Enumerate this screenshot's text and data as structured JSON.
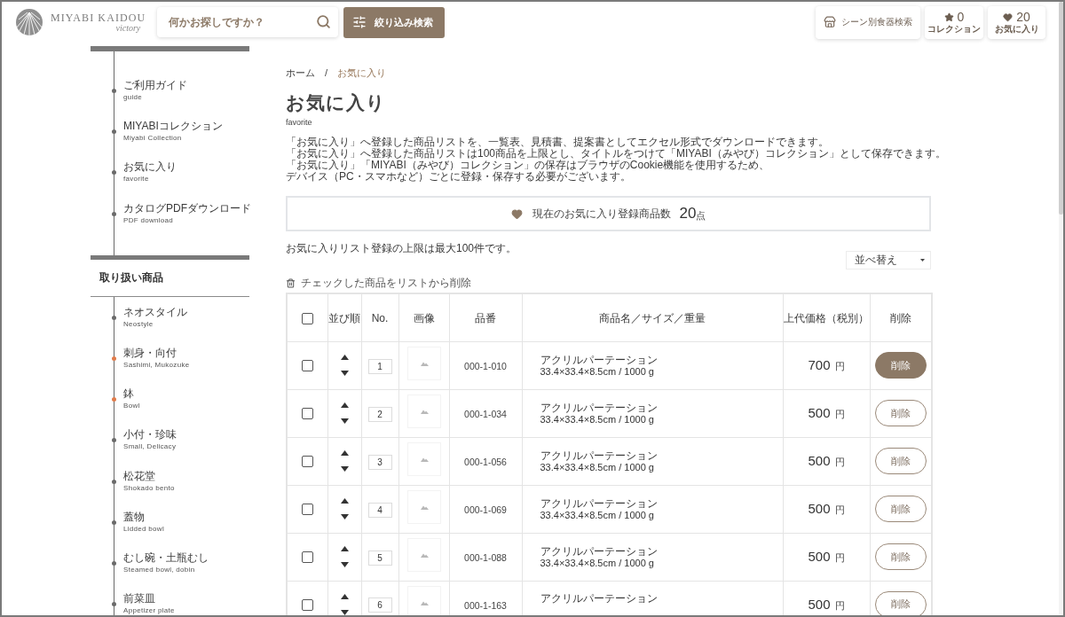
{
  "header": {
    "logo": {
      "name": "MIYABI KAIDOU",
      "tagline": "victory"
    },
    "search": {
      "placeholder": "何かお探しですか？"
    },
    "filter_button": "絞り込み検索",
    "scene_button": "シーン別食器検索",
    "collection_button": {
      "count": "0",
      "label": "コレクション"
    },
    "favorites_button": {
      "count": "20",
      "label": "お気に入り"
    }
  },
  "sidebar": {
    "guide_items": [
      {
        "label": "ご利用ガイド",
        "sublabel": "guide"
      },
      {
        "label": "MIYABIコレクション",
        "sublabel": "Miyabi Collection"
      },
      {
        "label": "お気に入り",
        "sublabel": "favorite"
      },
      {
        "label": "カタログPDFダウンロード",
        "sublabel": "PDF download"
      }
    ],
    "products_heading": "取り扱い商品",
    "product_items": [
      {
        "label": "ネオスタイル",
        "sublabel": "Neostyle",
        "selected": false
      },
      {
        "label": "刺身・向付",
        "sublabel": "Sashimi, Mukozuke",
        "selected": true
      },
      {
        "label": "鉢",
        "sublabel": "Bowl",
        "selected": true
      },
      {
        "label": "小付・珍味",
        "sublabel": "Small, Delicacy",
        "selected": false
      },
      {
        "label": "松花堂",
        "sublabel": "Shokado bento",
        "selected": false
      },
      {
        "label": "蓋物",
        "sublabel": "Lidded bowl",
        "selected": false
      },
      {
        "label": "むし碗・土瓶むし",
        "sublabel": "Steamed bowl, dobin",
        "selected": false
      },
      {
        "label": "前菜皿",
        "sublabel": "Appetizer plate",
        "selected": false
      }
    ]
  },
  "breadcrumb": {
    "separator": "/",
    "items": [
      {
        "label": "ホーム",
        "current": false
      },
      {
        "label": "お気に入り",
        "current": true
      }
    ]
  },
  "page": {
    "title": "お気に入り",
    "subtitle": "favorite",
    "description": [
      "「お気に入り」へ登録した商品リストを、一覧表、見積書、提案書としてエクセル形式でダウンロードできます。",
      "「お気に入り」へ登録した商品リストは100商品を上限とし、タイトルをつけて「MIYABI（みやび）コレクション」として保存できます。",
      "「お気に入り」「MIYABI（みやび）コレクション」の保存はブラウザのCookie機能を使用するため、",
      "デバイス（PC・スマホなど）ごとに登録・保存する必要がございます。"
    ],
    "count_box": {
      "label": "現在のお気に入り登録商品数",
      "count": "20",
      "unit": "点"
    },
    "limit_note": "お気に入りリスト登録の上限は最大100件です。",
    "sort_select": {
      "value": "並べ替え"
    },
    "bulk_delete": "チェックした商品をリストから削除"
  },
  "table": {
    "header_checkbox": {
      "checked": false
    },
    "columns": [
      "並び順",
      "No.",
      "画像",
      "品番",
      "商品名／サイズ／重量",
      "上代価格（税別）",
      "削除"
    ],
    "rows": [
      {
        "checked": false,
        "no": "1",
        "code": "000-1-010",
        "name": "アクリルパーテーション",
        "spec": "33.4×33.4×8.5cm / 1000 g",
        "price": "700",
        "currency": "円",
        "delete_button": {
          "label": "削除",
          "active": true
        }
      },
      {
        "checked": false,
        "no": "2",
        "code": "000-1-034",
        "name": "アクリルパーテーション",
        "spec": "33.4×33.4×8.5cm / 1000 g",
        "price": "500",
        "currency": "円",
        "delete_button": {
          "label": "削除",
          "active": false
        }
      },
      {
        "checked": false,
        "no": "3",
        "code": "000-1-056",
        "name": "アクリルパーテーション",
        "spec": "33.4×33.4×8.5cm / 1000 g",
        "price": "500",
        "currency": "円",
        "delete_button": {
          "label": "削除",
          "active": false
        }
      },
      {
        "checked": false,
        "no": "4",
        "code": "000-1-069",
        "name": "アクリルパーテーション",
        "spec": "33.4×33.4×8.5cm / 1000 g",
        "price": "500",
        "currency": "円",
        "delete_button": {
          "label": "削除",
          "active": false
        }
      },
      {
        "checked": false,
        "no": "5",
        "code": "000-1-088",
        "name": "アクリルパーテーション",
        "spec": "33.4×33.4×8.5cm / 1000 g",
        "price": "500",
        "currency": "円",
        "delete_button": {
          "label": "削除",
          "active": false
        }
      },
      {
        "checked": false,
        "no": "6",
        "code": "000-1-163",
        "name": "アクリルパーテーション",
        "price": "500",
        "currency": "円",
        "delete_button": {
          "label": "削除",
          "active": false
        }
      }
    ]
  }
}
